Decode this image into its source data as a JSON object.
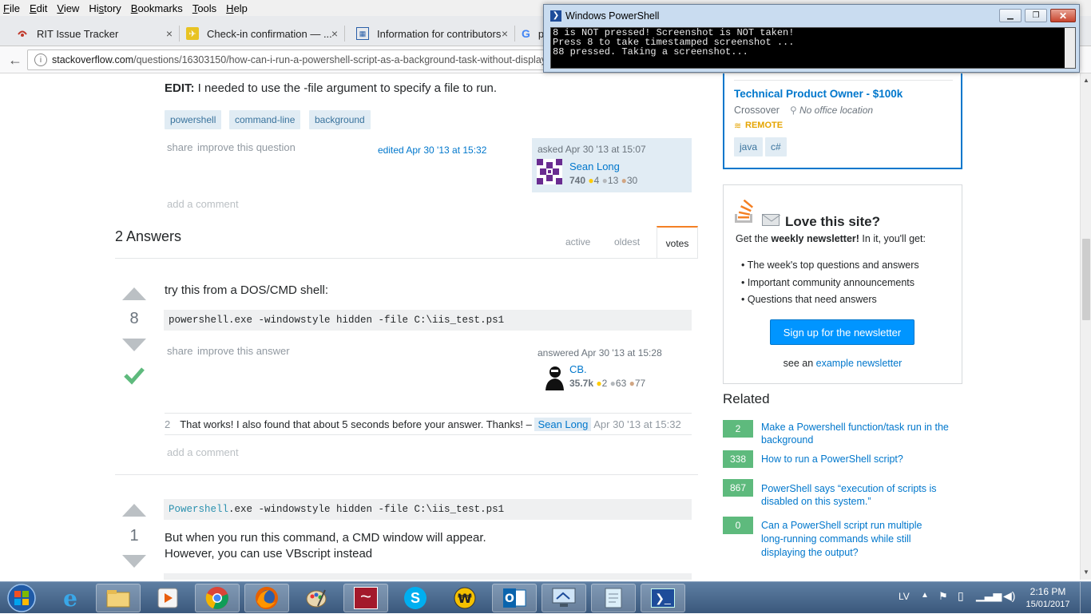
{
  "menubar": {
    "items": [
      {
        "pre": "",
        "key": "F",
        "post": "ile"
      },
      {
        "pre": "",
        "key": "E",
        "post": "dit"
      },
      {
        "pre": "",
        "key": "V",
        "post": "iew"
      },
      {
        "pre": "Hi",
        "key": "s",
        "post": "tory"
      },
      {
        "pre": "",
        "key": "B",
        "post": "ookmarks"
      },
      {
        "pre": "",
        "key": "T",
        "post": "ools"
      },
      {
        "pre": "",
        "key": "H",
        "post": "elp"
      }
    ]
  },
  "tabs": [
    {
      "title": "RIT Issue Tracker",
      "close": "×"
    },
    {
      "title": "Check-in confirmation — ...",
      "close": "×"
    },
    {
      "title": "Information for contributors",
      "close": "×"
    },
    {
      "title": "p",
      "close": ""
    }
  ],
  "urlbar": {
    "domain": "stackoverflow.com",
    "path": "/questions/16303150/how-can-i-run-a-powershell-script-as-a-background-task-without-displayi"
  },
  "powershell": {
    "title": "Windows PowerShell",
    "lines": [
      "8 is NOT pressed! Screenshot is NOT taken!",
      "Press 8 to take timestamped screenshot ...",
      "88 pressed. Taking a screenshot..."
    ]
  },
  "question": {
    "edit_label": "EDIT:",
    "edit_text": " I needed to use the -file argument to specify a file to run.",
    "tags": [
      "powershell",
      "command-line",
      "background"
    ],
    "share": "share",
    "improve": "improve this question",
    "edited": "edited Apr 30 '13 at 15:32",
    "asked": "asked Apr 30 '13 at 15:07",
    "user": {
      "name": "Sean Long",
      "rep": "740",
      "gold": "4",
      "silver": "13",
      "bronze": "30"
    },
    "add_comment": "add a comment"
  },
  "answers_header": {
    "title": "2 Answers",
    "tabs": [
      "active",
      "oldest",
      "votes"
    ]
  },
  "answer1": {
    "votes": "8",
    "text": "try this from a DOS/CMD shell:",
    "code": "powershell.exe -windowstyle hidden -file C:\\iis_test.ps1",
    "share": "share",
    "improve": "improve this answer",
    "answered": "answered Apr 30 '13 at 15:28",
    "user": {
      "name": "CB.",
      "rep": "35.7k",
      "gold": "2",
      "silver": "63",
      "bronze": "77"
    },
    "comment": {
      "score": "2",
      "text": "That works! I also found that about 5 seconds before your answer. Thanks! –",
      "user": "Sean Long",
      "time": "Apr 30 '13 at 15:32"
    },
    "add_comment": "add a comment"
  },
  "answer2": {
    "votes": "1",
    "code_kw": "Powershell",
    "code_rest": ".exe -windowstyle hidden -file C:\\iis_test.ps1",
    "text1": "But when you run this command, a CMD window will appear.",
    "text2": "However, you can use VBscript instead"
  },
  "job": {
    "title": "Technical Product Owner - $100k",
    "company": "Crossover",
    "location": "No office location",
    "remote": "REMOTE",
    "tags": [
      "java",
      "c#"
    ]
  },
  "newsletter": {
    "title": "Love this site?",
    "intro_pre": "Get the ",
    "intro_bold": "weekly newsletter!",
    "intro_post": " In it, you'll get:",
    "bullets": [
      "The week's top questions and answers",
      "Important community announcements",
      "Questions that need answers"
    ],
    "button": "Sign up for the newsletter",
    "see_pre": "see an ",
    "see_link": "example newsletter"
  },
  "related": {
    "title": "Related",
    "items": [
      {
        "score": "2",
        "line1": "Make a Powershell function/task run in the",
        "line2": "background",
        "line3": ""
      },
      {
        "score": "338",
        "line1": "How to run a PowerShell script?",
        "line2": "",
        "line3": ""
      },
      {
        "score": "867",
        "line1": "PowerShell says “execution of scripts is",
        "line2": "disabled on this system.”",
        "line3": ""
      },
      {
        "score": "0",
        "line1": "Can a PowerShell script run multiple",
        "line2": "long-running commands while still",
        "line3": "displaying the output?"
      }
    ]
  },
  "tray": {
    "lang": "LV",
    "time": "2:16 PM",
    "date": "15/01/2017"
  },
  "colors": {
    "accent": "#07c",
    "tag_bg": "#e1ecf4",
    "accepted": "#5eba7d",
    "score_bg": "#5eba7d",
    "button": "#0095ff"
  }
}
